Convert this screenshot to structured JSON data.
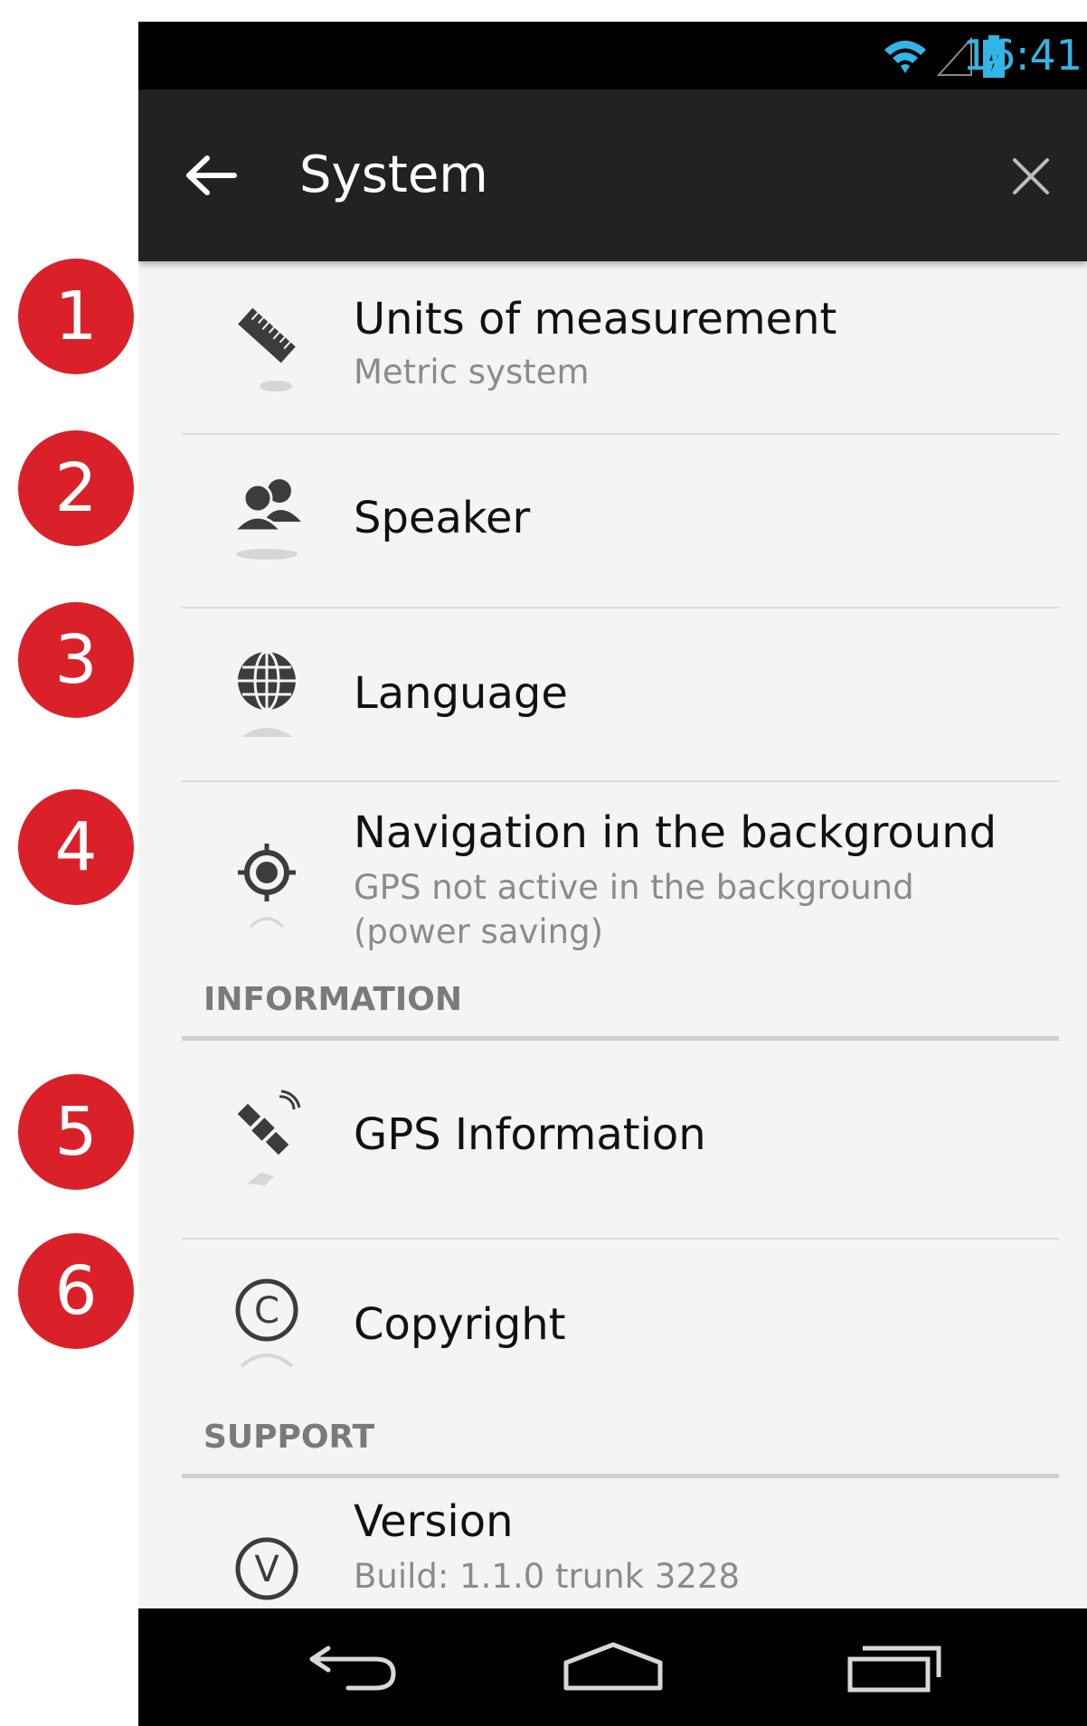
{
  "badges": [
    "1",
    "2",
    "3",
    "4",
    "5",
    "6"
  ],
  "status_bar": {
    "time": "16:41"
  },
  "header": {
    "title": "System"
  },
  "items": [
    {
      "label": "Units of measurement",
      "sub": "Metric system",
      "icon": "ruler-icon"
    },
    {
      "label": "Speaker",
      "icon": "speaker-people-icon"
    },
    {
      "label": "Language",
      "icon": "globe-icon"
    },
    {
      "label": "Navigation in the background",
      "sub": "GPS not active in the background",
      "sub2": "(power saving)",
      "icon": "gps-target-icon"
    },
    {
      "label": "GPS Information",
      "icon": "satellite-icon"
    },
    {
      "label": "Copyright",
      "icon": "copyright-icon"
    },
    {
      "label": "Version",
      "sub": "Build: 1.1.0 trunk 3228",
      "icon": "version-icon"
    }
  ],
  "sections": {
    "information": "INFORMATION",
    "support": "SUPPORT"
  },
  "colors": {
    "badge": "#da2129",
    "status_accent": "#33b5e5",
    "action_bar": "#222222",
    "list_bg": "#f4f4f4"
  }
}
